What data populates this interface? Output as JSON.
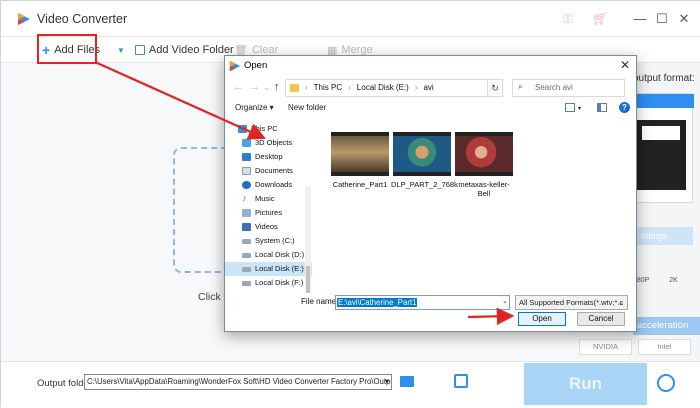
{
  "app": {
    "title": "Video Converter",
    "colors": {
      "accent": "#2f8ef0",
      "annotation": "#e02424"
    },
    "window_controls": {
      "minimize": "—",
      "maximize": "☐",
      "close": "✕"
    }
  },
  "toolbar": {
    "add_files": "Add Files",
    "add_video_folder": "Add Video Folder",
    "clear": "Clear",
    "merge": "Merge"
  },
  "workspace": {
    "click_hint": "Click th"
  },
  "right_panel": {
    "output_format_label": "output format:",
    "settings_label": "ettings",
    "quality_labels": [
      "080P",
      "2K"
    ],
    "gpu_label": "acceleration",
    "nvidia": "NVIDIA",
    "intel": "Intel"
  },
  "bottom": {
    "output_folder_label": "Output folder:",
    "output_folder_value": "C:\\Users\\Vita\\AppData\\Roaming\\WonderFox Soft\\HD Video Converter Factory Pro\\OutputVideo\\",
    "run": "Run"
  },
  "dialog": {
    "title": "Open",
    "close": "✕",
    "breadcrumb": [
      "This PC",
      "Local Disk (E:)",
      "avi"
    ],
    "search_placeholder": "Search avi",
    "organize": "Organize ▾",
    "new_folder": "New folder",
    "nav_items": [
      {
        "label": "This PC",
        "icon": "computer-icon",
        "selected": false
      },
      {
        "label": "3D Objects",
        "icon": "cube-icon",
        "selected": false
      },
      {
        "label": "Desktop",
        "icon": "desktop-icon",
        "selected": false
      },
      {
        "label": "Documents",
        "icon": "documents-icon",
        "selected": false
      },
      {
        "label": "Downloads",
        "icon": "download-icon",
        "selected": false
      },
      {
        "label": "Music",
        "icon": "music-icon",
        "selected": false
      },
      {
        "label": "Pictures",
        "icon": "pictures-icon",
        "selected": false
      },
      {
        "label": "Videos",
        "icon": "videos-icon",
        "selected": false
      },
      {
        "label": "System (C:)",
        "icon": "drive-icon",
        "selected": false
      },
      {
        "label": "Local Disk (D:)",
        "icon": "drive-icon",
        "selected": false
      },
      {
        "label": "Local Disk (E:)",
        "icon": "drive-icon",
        "selected": true
      },
      {
        "label": "Local Disk (F:)",
        "icon": "drive-icon",
        "selected": false
      }
    ],
    "files": [
      {
        "name": "Catherine_Part1"
      },
      {
        "name": "DLP_PART_2_768k"
      },
      {
        "name": "metaxas-keller-Bell"
      }
    ],
    "file_name_label": "File name:",
    "file_name_value": "E:\\avi\\Catherine_Part1",
    "file_type": "All Supported Formats(*.wtv;*.c",
    "open": "Open",
    "cancel": "Cancel"
  }
}
